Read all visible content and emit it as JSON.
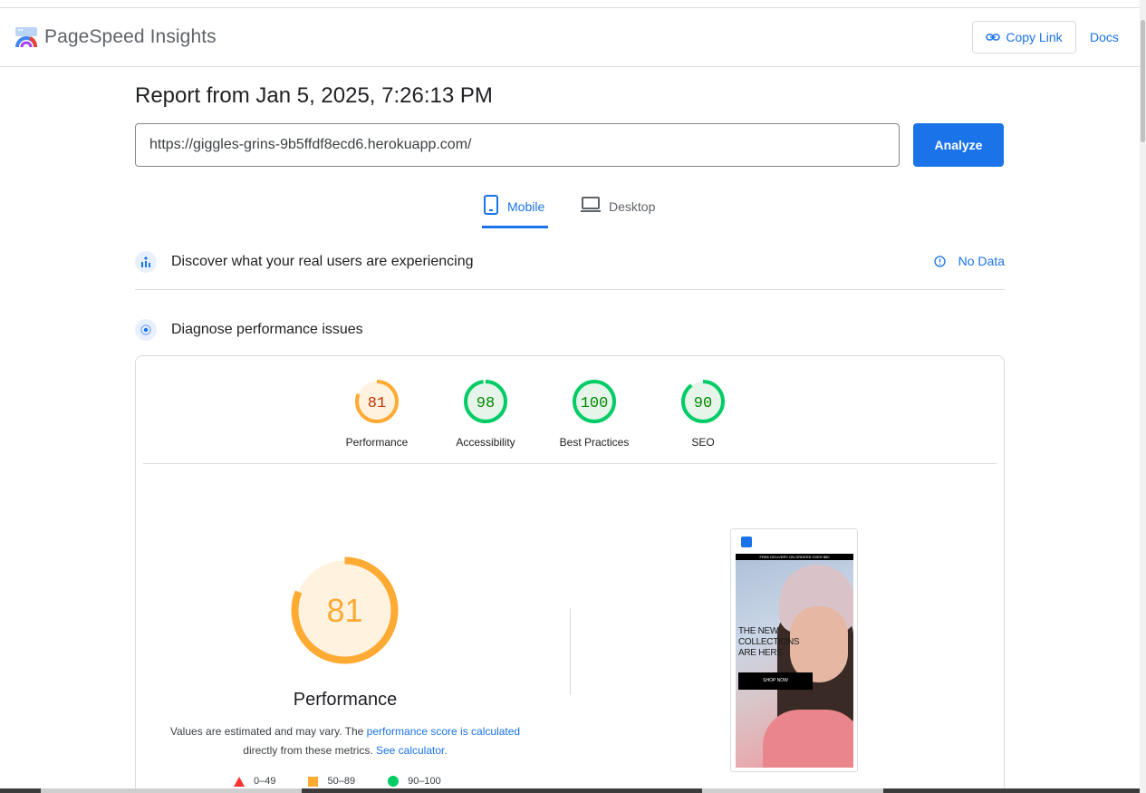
{
  "header": {
    "brand": "PageSpeed Insights",
    "copy_link_label": "Copy Link",
    "docs_label": "Docs"
  },
  "report": {
    "title": "Report from Jan 5, 2025, 7:26:13 PM",
    "url_value": "https://giggles-grins-9b5ffdf8ecd6.herokuapp.com/",
    "analyze_label": "Analyze"
  },
  "tabs": [
    {
      "label": "Mobile",
      "active": true
    },
    {
      "label": "Desktop",
      "active": false
    }
  ],
  "sections": {
    "real_users": {
      "title": "Discover what your real users are experiencing",
      "status": "No Data"
    },
    "diagnose": {
      "title": "Diagnose performance issues"
    }
  },
  "scores": [
    {
      "label": "Performance",
      "value": "81",
      "color": "#fa3",
      "text_color": "#c33300",
      "fill": "#fff3e0"
    },
    {
      "label": "Accessibility",
      "value": "98",
      "color": "#0c6",
      "text_color": "#008800",
      "fill": "#e6f4ea"
    },
    {
      "label": "Best Practices",
      "value": "100",
      "color": "#0c6",
      "text_color": "#008800",
      "fill": "#e6f4ea"
    },
    {
      "label": "SEO",
      "value": "90",
      "color": "#0c6",
      "text_color": "#008800",
      "fill": "#e6f4ea"
    }
  ],
  "performance": {
    "score": "81",
    "title": "Performance",
    "desc_prefix": "Values are estimated and may vary. The ",
    "desc_link1": "performance score is calculated",
    "desc_middle": " directly from these metrics. ",
    "desc_link2": "See calculator.",
    "legend": [
      {
        "range": "0–49",
        "shape": "triangle",
        "color": "#f33"
      },
      {
        "range": "50–89",
        "shape": "square",
        "color": "#fa3"
      },
      {
        "range": "90–100",
        "shape": "circle",
        "color": "#0c6"
      }
    ]
  },
  "screenshot": {
    "banner": "FREE DELIVERY ON ORDERS OVER $50",
    "headline_1": "THE NEW",
    "headline_2": "COLLECTIONS",
    "headline_3": "ARE HERE",
    "button": "SHOP NOW"
  }
}
